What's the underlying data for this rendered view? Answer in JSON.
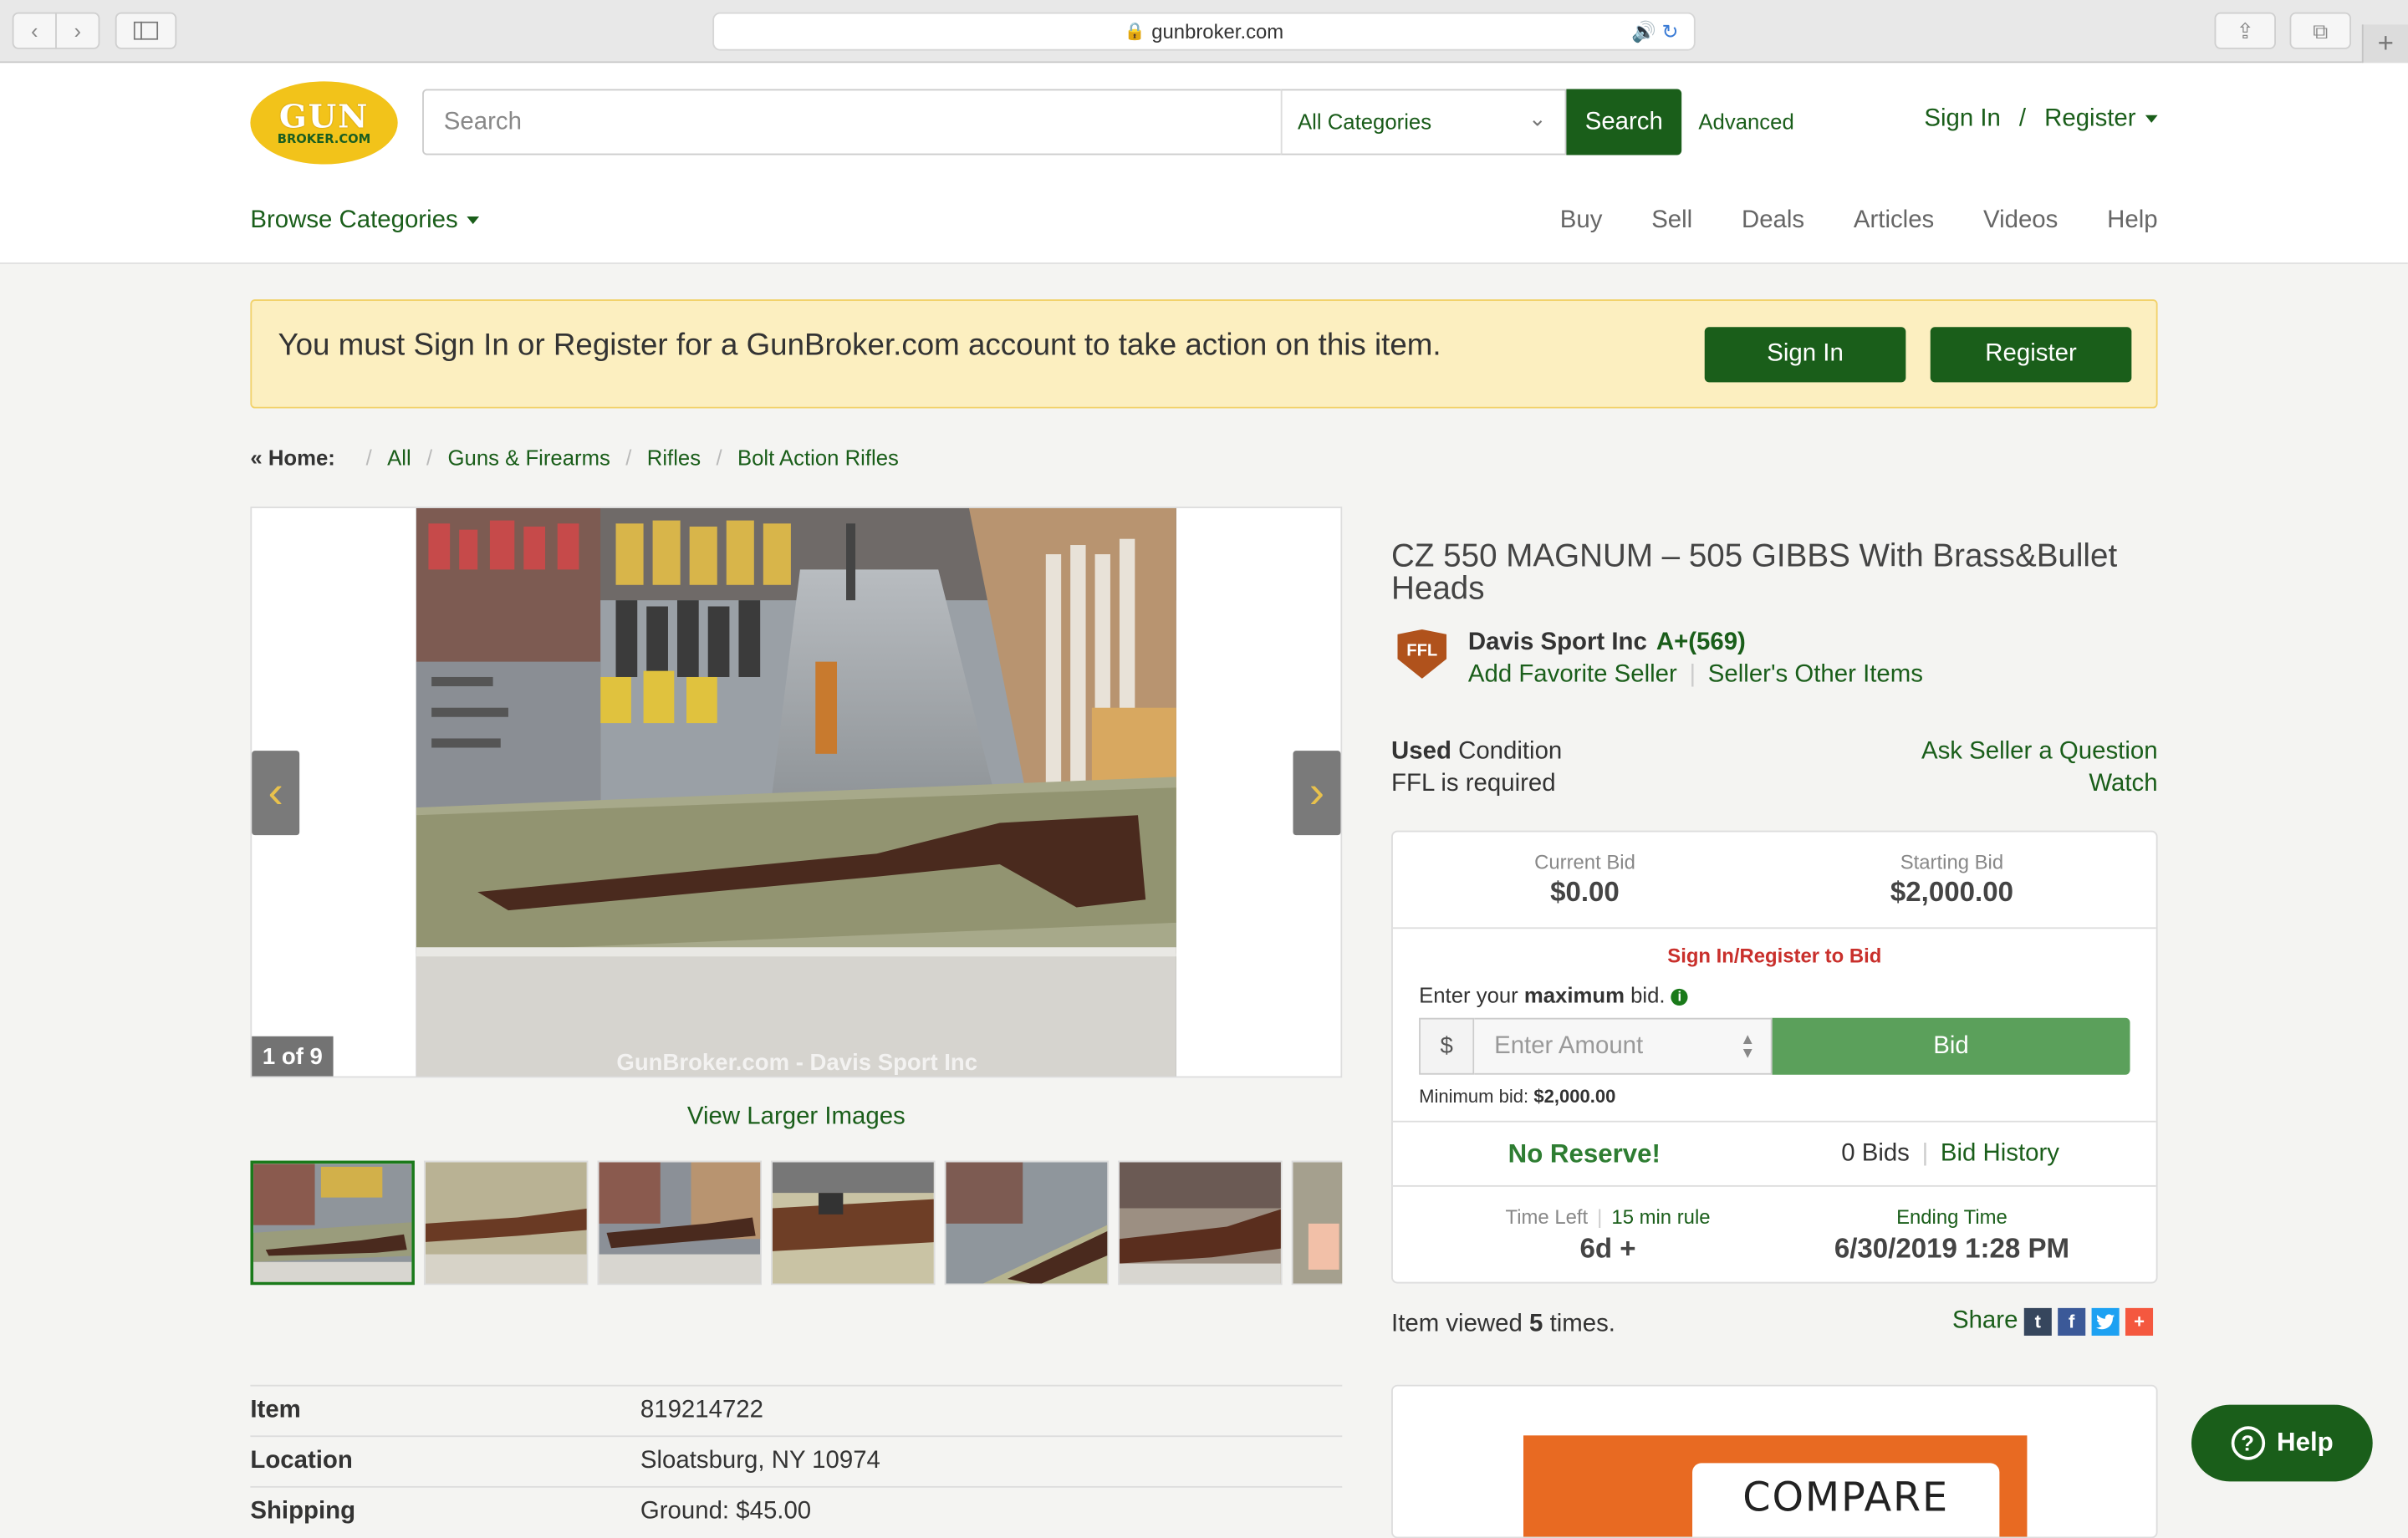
{
  "browser": {
    "url": "gunbroker.com"
  },
  "header": {
    "logo_top": "GUN",
    "logo_bottom": "BROKER.COM",
    "search_placeholder": "Search",
    "category_selected": "All Categories",
    "search_button": "Search",
    "advanced_link": "Advanced",
    "sign_in": "Sign In",
    "separator": "/",
    "register": "Register",
    "browse_categories": "Browse Categories",
    "nav": [
      "Buy",
      "Sell",
      "Deals",
      "Articles",
      "Videos",
      "Help"
    ]
  },
  "alert": {
    "message": "You must Sign In or Register for a GunBroker.com account to take action on this item.",
    "sign_in_button": "Sign In",
    "register_button": "Register"
  },
  "breadcrumb": {
    "home": "« Home:",
    "items": [
      "All",
      "Guns & Firearms",
      "Rifles",
      "Bolt Action Rifles"
    ]
  },
  "gallery": {
    "counter": "1 of 9",
    "view_larger": "View Larger Images",
    "watermark": "GunBroker.com - Davis Sport Inc",
    "thumbnail_count": 7
  },
  "details": [
    {
      "label": "Item",
      "value": "819214722"
    },
    {
      "label": "Location",
      "value": "Sloatsburg, NY 10974"
    },
    {
      "label": "Shipping",
      "value": "Ground: $45.00"
    }
  ],
  "item": {
    "title": "CZ 550 MAGNUM – 505 GIBBS With Brass&Bullet Heads",
    "seller_badge": "FFL",
    "seller_name": "Davis Sport Inc",
    "seller_rating": "A+(569)",
    "add_favorite": "Add Favorite Seller",
    "other_items": "Seller's Other Items",
    "condition_bold": "Used",
    "condition_label": "Condition",
    "ffl_required": "FFL is required",
    "ask_question": "Ask Seller a Question",
    "watch": "Watch"
  },
  "bid": {
    "current_bid_label": "Current Bid",
    "current_bid": "$0.00",
    "starting_bid_label": "Starting Bid",
    "starting_bid": "$2,000.00",
    "sign_in_to_bid": "Sign In/Register to Bid",
    "enter_prefix": "Enter your",
    "enter_bold": "maximum",
    "enter_suffix": "bid.",
    "currency": "$",
    "amount_placeholder": "Enter Amount",
    "bid_button": "Bid",
    "min_bid_label": "Minimum bid:",
    "min_bid_value": "$2,000.00",
    "no_reserve": "No Reserve!",
    "bids_count": "0 Bids",
    "bid_history": "Bid History",
    "time_left_label": "Time Left",
    "min_rule": "15 min rule",
    "time_left": "6d +",
    "ending_time_label": "Ending Time",
    "ending_time": "6/30/2019 1:28 PM"
  },
  "viewed": {
    "prefix": "Item viewed",
    "count": "5",
    "suffix": "times."
  },
  "share": {
    "label": "Share",
    "icons": [
      "tumblr-icon",
      "facebook-icon",
      "twitter-icon",
      "addthis-icon"
    ]
  },
  "ad": {
    "text": "COMPARE"
  },
  "help_button": "Help",
  "colors": {
    "brand_green": "#1a5e1a",
    "bid_green": "#5ba05b",
    "alert_bg": "#fcefc0",
    "logo_yellow": "#f2c31a",
    "error_red": "#c9302c"
  }
}
